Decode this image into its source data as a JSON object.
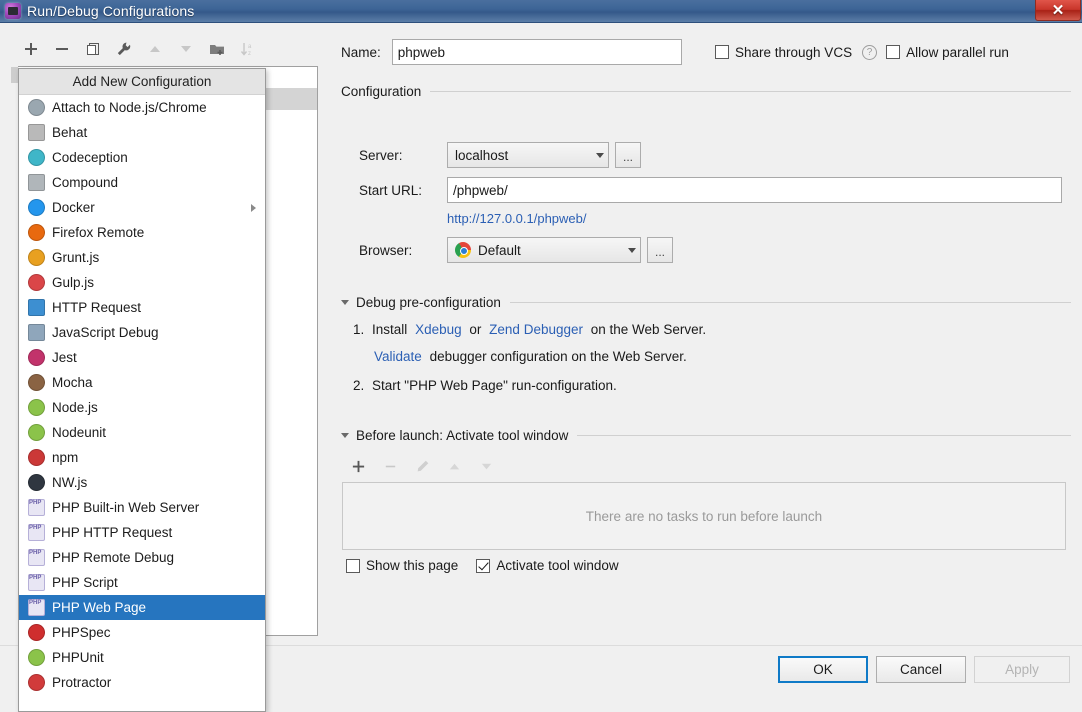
{
  "window": {
    "title": "Run/Debug Configurations",
    "app_icon": "intellij-app-icon",
    "close_label": "✕"
  },
  "config_toolbar": {
    "buttons": [
      {
        "name": "add-configuration-button",
        "icon": "plus-icon",
        "enabled": true
      },
      {
        "name": "remove-configuration-button",
        "icon": "minus-icon",
        "enabled": true
      },
      {
        "name": "copy-configuration-button",
        "icon": "copy-icon",
        "enabled": true
      },
      {
        "name": "edit-templates-button",
        "icon": "wrench-icon",
        "enabled": true
      },
      {
        "name": "move-up-button",
        "icon": "arrow-up-icon",
        "enabled": false
      },
      {
        "name": "move-down-button",
        "icon": "arrow-down-icon",
        "enabled": false
      },
      {
        "name": "new-folder-button",
        "icon": "folder-add-icon",
        "enabled": true
      },
      {
        "name": "sort-alphabetically-button",
        "icon": "sort-az-icon",
        "enabled": false
      }
    ]
  },
  "popup": {
    "header": "Add New Configuration",
    "items": [
      {
        "label": "Attach to Node.js/Chrome",
        "icon": "node-attach-icon",
        "color": "#9aa7b0",
        "selected": false,
        "submenu": false
      },
      {
        "label": "Behat",
        "icon": "behat-icon",
        "color": "#b9b9b9",
        "selected": false,
        "submenu": false
      },
      {
        "label": "Codeception",
        "icon": "codeception-icon",
        "color": "#3fb6c8",
        "selected": false,
        "submenu": false
      },
      {
        "label": "Compound",
        "icon": "compound-icon",
        "color": "#b0b6ba",
        "selected": false,
        "submenu": false
      },
      {
        "label": "Docker",
        "icon": "docker-icon",
        "color": "#2496ed",
        "selected": false,
        "submenu": true
      },
      {
        "label": "Firefox Remote",
        "icon": "firefox-icon",
        "color": "#e8690f",
        "selected": false,
        "submenu": false
      },
      {
        "label": "Grunt.js",
        "icon": "grunt-icon",
        "color": "#e8a020",
        "selected": false,
        "submenu": false
      },
      {
        "label": "Gulp.js",
        "icon": "gulp-icon",
        "color": "#da4648",
        "selected": false,
        "submenu": false
      },
      {
        "label": "HTTP Request",
        "icon": "http-request-icon",
        "color": "#3d8fd1",
        "selected": false,
        "submenu": false
      },
      {
        "label": "JavaScript Debug",
        "icon": "javascript-debug-icon",
        "color": "#8fa6bb",
        "selected": false,
        "submenu": false
      },
      {
        "label": "Jest",
        "icon": "jest-icon",
        "color": "#c2336b",
        "selected": false,
        "submenu": false
      },
      {
        "label": "Mocha",
        "icon": "mocha-icon",
        "color": "#8a6343",
        "selected": false,
        "submenu": false
      },
      {
        "label": "Node.js",
        "icon": "nodejs-icon",
        "color": "#8bc34a",
        "selected": false,
        "submenu": false
      },
      {
        "label": "Nodeunit",
        "icon": "nodeunit-icon",
        "color": "#8bc34a",
        "selected": false,
        "submenu": false
      },
      {
        "label": "npm",
        "icon": "npm-icon",
        "color": "#cb3837",
        "selected": false,
        "submenu": false
      },
      {
        "label": "NW.js",
        "icon": "nwjs-icon",
        "color": "#2f3640",
        "selected": false,
        "submenu": false
      },
      {
        "label": "PHP Built-in Web Server",
        "icon": "php-icon",
        "color": "#7a6fb0",
        "selected": false,
        "submenu": false
      },
      {
        "label": "PHP HTTP Request",
        "icon": "php-icon",
        "color": "#7a6fb0",
        "selected": false,
        "submenu": false
      },
      {
        "label": "PHP Remote Debug",
        "icon": "php-icon",
        "color": "#7a6fb0",
        "selected": false,
        "submenu": false
      },
      {
        "label": "PHP Script",
        "icon": "php-icon",
        "color": "#7a6fb0",
        "selected": false,
        "submenu": false
      },
      {
        "label": "PHP Web Page",
        "icon": "php-icon",
        "color": "#7a6fb0",
        "selected": true,
        "submenu": false
      },
      {
        "label": "PHPSpec",
        "icon": "phpspec-icon",
        "color": "#cf2e2e",
        "selected": false,
        "submenu": false
      },
      {
        "label": "PHPUnit",
        "icon": "phpunit-icon",
        "color": "#8bc34a",
        "selected": false,
        "submenu": false
      },
      {
        "label": "Protractor",
        "icon": "protractor-icon",
        "color": "#d13b3b",
        "selected": false,
        "submenu": false
      }
    ]
  },
  "form": {
    "name_label": "Name:",
    "name_value": "phpweb",
    "share_vcs_label": "Share through VCS",
    "share_vcs_checked": false,
    "help_icon": "question-mark-icon",
    "allow_parallel_label": "Allow parallel run",
    "allow_parallel_checked": false,
    "configuration_section": "Configuration",
    "server_label": "Server:",
    "server_value": "localhost",
    "server_browse": "...",
    "start_url_label": "Start URL:",
    "start_url_value": "/phpweb/",
    "resolved_url": "http://127.0.0.1/phpweb/",
    "browser_label": "Browser:",
    "browser_value": "Default",
    "browser_icon": "chrome-icon",
    "browser_browse": "..."
  },
  "debug_section": {
    "title": "Debug pre-configuration",
    "step1_num": "1.",
    "step1_a": "Install",
    "step1_link1": "Xdebug",
    "step1_or": "or",
    "step1_link2": "Zend Debugger",
    "step1_b": "on the Web Server.",
    "validate_link": "Validate",
    "validate_rest": "debugger configuration on the Web Server.",
    "step2_num": "2.",
    "step2_text": "Start \"PHP Web Page\" run-configuration."
  },
  "before_launch": {
    "title": "Before launch: Activate tool window",
    "toolbar": [
      {
        "name": "add-task-button",
        "icon": "plus-icon",
        "enabled": true
      },
      {
        "name": "remove-task-button",
        "icon": "minus-icon",
        "enabled": false
      },
      {
        "name": "edit-task-button",
        "icon": "pencil-icon",
        "enabled": false
      },
      {
        "name": "move-task-up-button",
        "icon": "arrow-up-icon",
        "enabled": false
      },
      {
        "name": "move-task-down-button",
        "icon": "arrow-down-icon",
        "enabled": false
      }
    ],
    "empty_text": "There are no tasks to run before launch",
    "show_page_label": "Show this page",
    "show_page_checked": false,
    "activate_tool_window_label": "Activate tool window",
    "activate_tool_window_checked": true
  },
  "buttons": {
    "ok": "OK",
    "cancel": "Cancel",
    "apply": "Apply",
    "apply_enabled": false
  },
  "colors": {
    "accent": "#2675bf",
    "link": "#2b5fb4",
    "titlebar": "#3d6596",
    "close": "#c8352a"
  }
}
